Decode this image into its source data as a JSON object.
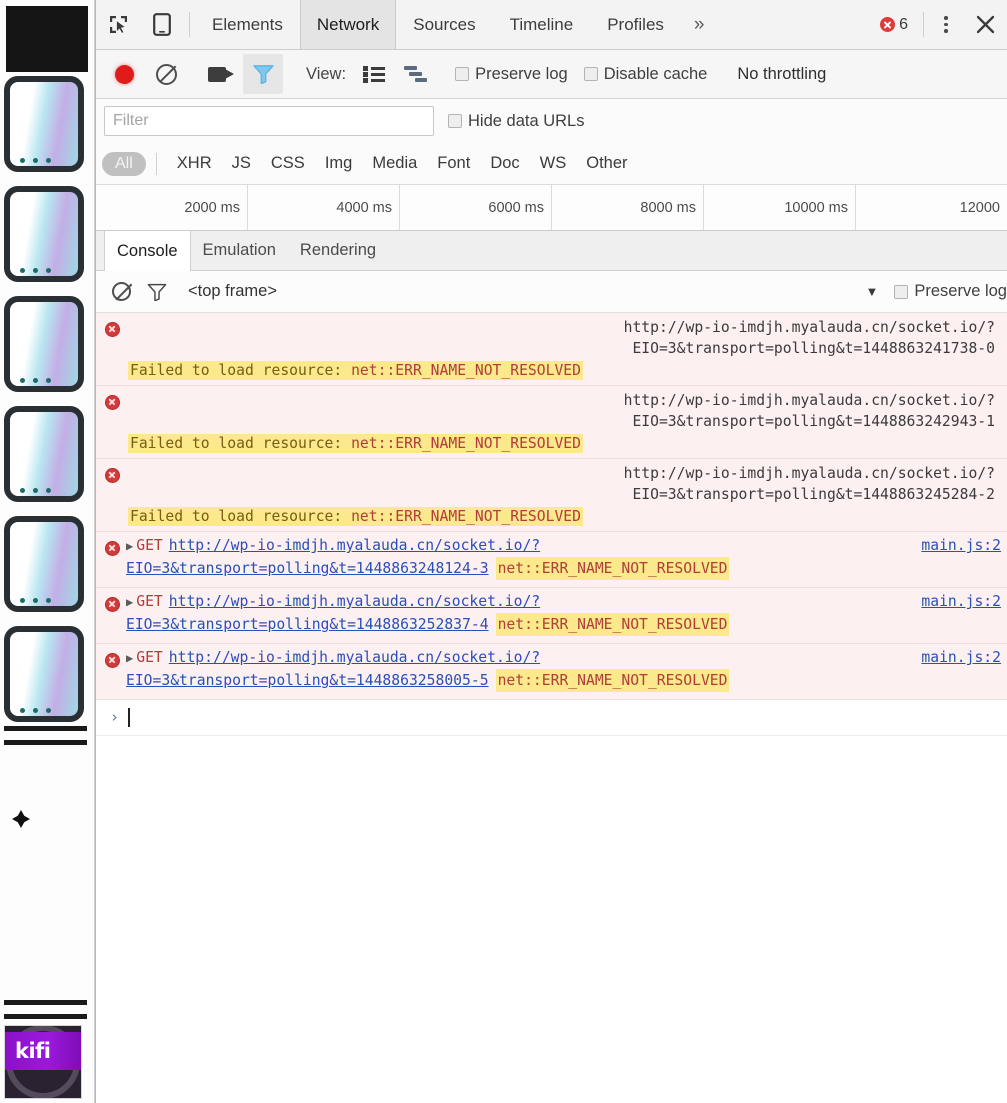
{
  "page_strip": {
    "badge_text": "kifi"
  },
  "devtools": {
    "tabs": [
      {
        "label": "Elements",
        "selected": false
      },
      {
        "label": "Network",
        "selected": true
      },
      {
        "label": "Sources",
        "selected": false
      },
      {
        "label": "Timeline",
        "selected": false
      },
      {
        "label": "Profiles",
        "selected": false
      }
    ],
    "more_tabs_label": "»",
    "error_count": "6",
    "inspect_icon": "inspect-element-icon",
    "device_icon": "device-toolbar-icon",
    "menu_icon": "kebab-menu-icon",
    "close_icon": "close-icon"
  },
  "network_toolbar": {
    "record_icon": "record-button-icon",
    "clear_icon": "clear-icon",
    "capture_screenshots_icon": "camera-icon",
    "filter_icon": "funnel-filter-icon",
    "view_label": "View:",
    "view_list_icon": "list-view-icon",
    "view_waterfall_icon": "waterfall-view-icon",
    "preserve_log_label": "Preserve log",
    "preserve_log_checked": false,
    "disable_cache_label": "Disable cache",
    "disable_cache_checked": false,
    "throttling_label": "No throttling"
  },
  "filter_row": {
    "filter_value": "",
    "filter_placeholder": "Filter",
    "hide_data_urls_label": "Hide data URLs",
    "hide_data_urls_checked": false
  },
  "type_filters": {
    "all_label": "All",
    "items": [
      "XHR",
      "JS",
      "CSS",
      "Img",
      "Media",
      "Font",
      "Doc",
      "WS",
      "Other"
    ]
  },
  "timeline_ruler": {
    "ticks": [
      "2000 ms",
      "4000 ms",
      "6000 ms",
      "8000 ms",
      "10000 ms",
      "12000"
    ]
  },
  "drawer": {
    "tabs": [
      {
        "label": "Console",
        "selected": true
      },
      {
        "label": "Emulation",
        "selected": false
      },
      {
        "label": "Rendering",
        "selected": false
      }
    ]
  },
  "console_bar": {
    "clear_icon": "clear-console-icon",
    "filter_icon": "funnel-filter-icon",
    "frame_label": "<top frame>",
    "dropdown_icon": "chevron-down-icon",
    "preserve_log_label": "Preserve log",
    "preserve_log_checked": false
  },
  "console_messages": [
    {
      "kind": "resource-error",
      "url_line1": "http://wp-io-imdjh.myalauda.cn/socket.io/?",
      "url_line2": "EIO=3&transport=polling&t=1448863241738-0",
      "fail_prefix": "Failed to load resource: ",
      "fail_code": "net::ERR_NAME_NOT_RESOLVED"
    },
    {
      "kind": "resource-error",
      "url_line1": "http://wp-io-imdjh.myalauda.cn/socket.io/?",
      "url_line2": "EIO=3&transport=polling&t=1448863242943-1",
      "fail_prefix": "Failed to load resource: ",
      "fail_code": "net::ERR_NAME_NOT_RESOLVED"
    },
    {
      "kind": "resource-error",
      "url_line1": "http://wp-io-imdjh.myalauda.cn/socket.io/?",
      "url_line2": "EIO=3&transport=polling&t=1448863245284-2",
      "fail_prefix": "Failed to load resource: ",
      "fail_code": "net::ERR_NAME_NOT_RESOLVED"
    },
    {
      "kind": "get-error",
      "verb": "GET",
      "url_line1": "http://wp-io-imdjh.myalauda.cn/socket.io/?",
      "url_line2": "EIO=3&transport=polling&t=1448863248124-3",
      "fail_code": "net::ERR_NAME_NOT_RESOLVED",
      "source": "main.js:2"
    },
    {
      "kind": "get-error",
      "verb": "GET",
      "url_line1": "http://wp-io-imdjh.myalauda.cn/socket.io/?",
      "url_line2": "EIO=3&transport=polling&t=1448863252837-4",
      "fail_code": "net::ERR_NAME_NOT_RESOLVED",
      "source": "main.js:2"
    },
    {
      "kind": "get-error",
      "verb": "GET",
      "url_line1": "http://wp-io-imdjh.myalauda.cn/socket.io/?",
      "url_line2": "EIO=3&transport=polling&t=1448863258005-5",
      "fail_code": "net::ERR_NAME_NOT_RESOLVED",
      "source": "main.js:2"
    }
  ],
  "console_prompt": {
    "chevron": "›",
    "value": ""
  },
  "colors": {
    "error_row_bg": "#fdf0f1",
    "highlight_yellow": "#fbe98b",
    "error_red": "#d33a3a",
    "link_blue": "#2a4fb8",
    "record_red": "#e01b1b",
    "kifi_purple": "#9b19dd"
  }
}
